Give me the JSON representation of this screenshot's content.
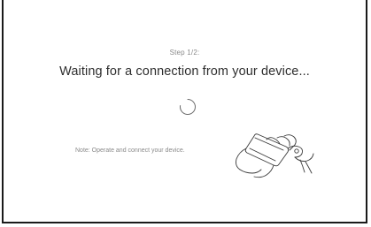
{
  "connection_screen": {
    "step": "Step 1/2:",
    "title": "Waiting for a connection from your device...",
    "note": "Note: Operate and connect your device."
  },
  "icons": {
    "spinner": "loading-spinner-icon",
    "illustration": "hand-holding-phone-icon"
  },
  "colors": {
    "background": "#ffffff",
    "frame": "#1a1a1a",
    "title_text": "#2e2e2e",
    "secondary_text": "#8a8a8a"
  }
}
